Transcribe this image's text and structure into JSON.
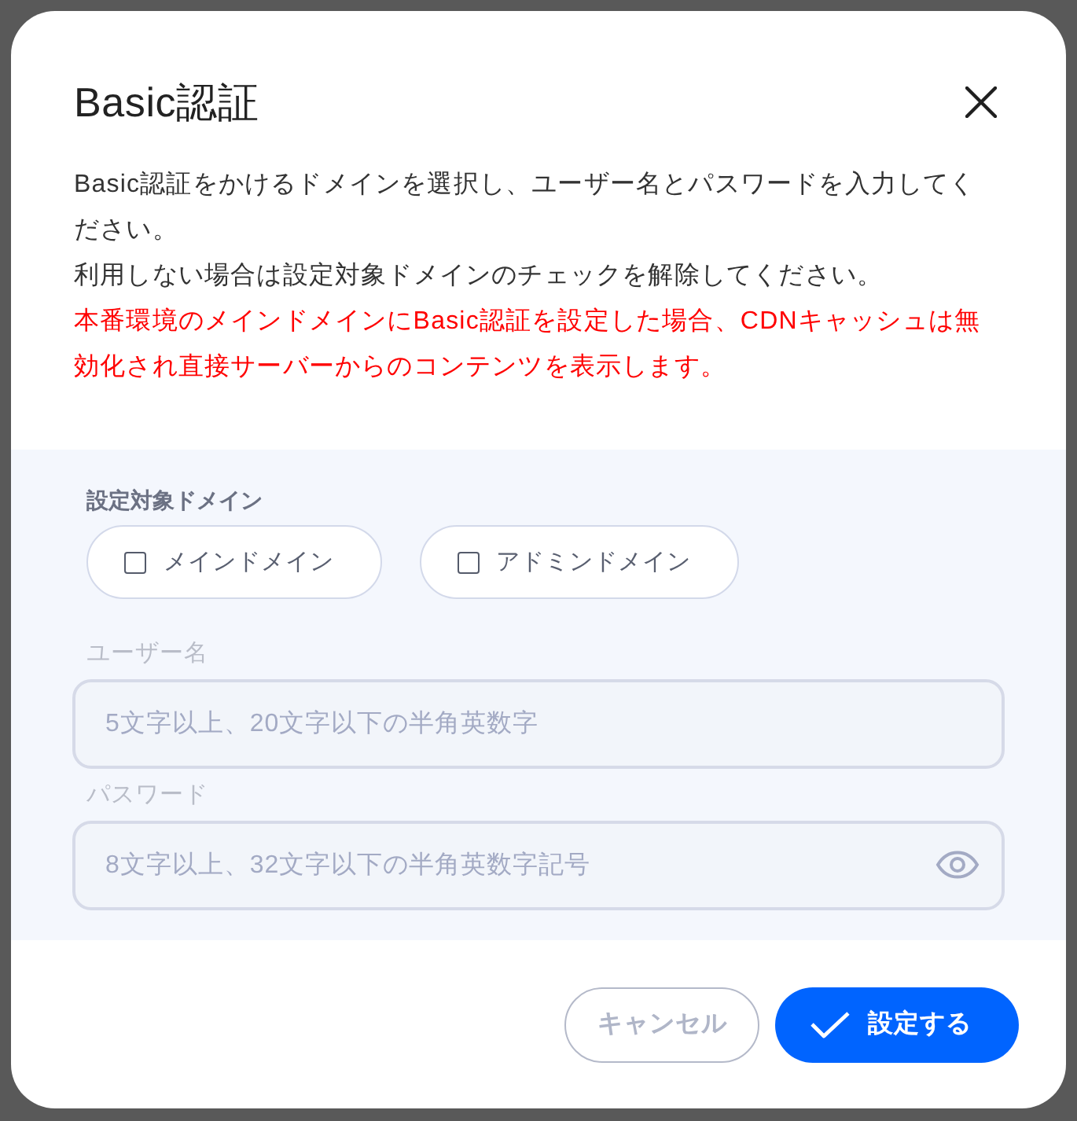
{
  "dialog": {
    "title": "Basic認証",
    "description": [
      {
        "kind": "normal",
        "text": "Basic認証をかけるドメインを選択し、ユーザー名とパスワードを入力してください。"
      },
      {
        "kind": "normal",
        "text": "利用しない場合は設定対象ドメインのチェックを解除してください。"
      },
      {
        "kind": "warning",
        "text": "本番環境のメインドメインにBasic認証を設定した場合、CDNキャッシュは無効化され直接サーバーからのコンテンツを表示します。"
      }
    ],
    "domain_selector": {
      "label": "設定対象ドメイン",
      "options": [
        {
          "label": "メインドメイン",
          "checked": false
        },
        {
          "label": "アドミンドメイン",
          "checked": false
        }
      ]
    },
    "fields": [
      {
        "kind": "text",
        "label": "ユーザー名",
        "placeholder": "5文字以上、20文字以下の半角英数字",
        "disabled": true
      },
      {
        "kind": "password",
        "label": "パスワード",
        "placeholder": "8文字以上、32文字以下の半角英数字記号",
        "disabled": true
      }
    ],
    "buttons": [
      {
        "kind": "secondary",
        "label": "キャンセル"
      },
      {
        "kind": "primary",
        "label": "設定する"
      }
    ]
  }
}
